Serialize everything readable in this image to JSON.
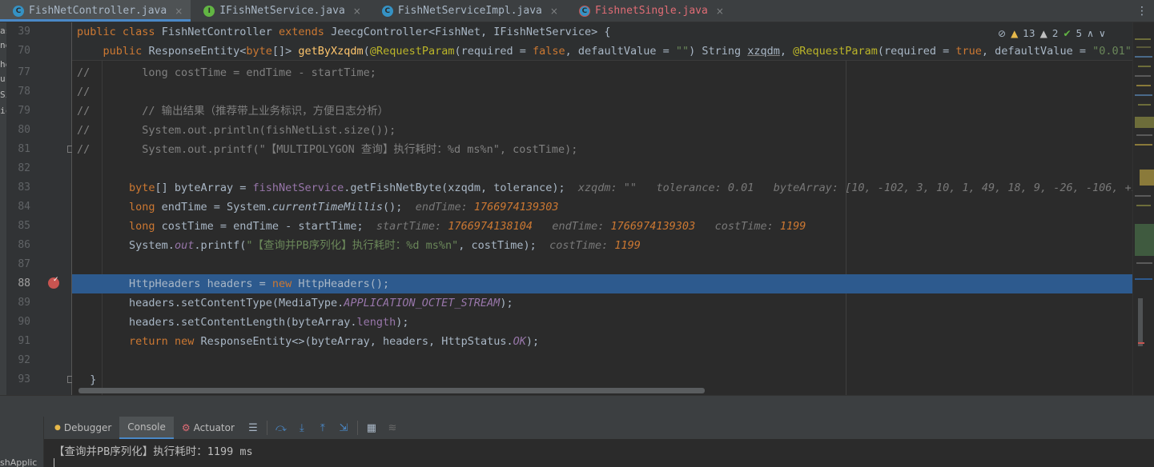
{
  "tabs": [
    {
      "label": "FishNetController.java",
      "icon": "class-icon",
      "active": true
    },
    {
      "label": "IFishNetService.java",
      "icon": "interface-icon",
      "active": false
    },
    {
      "label": "FishNetServiceImpl.java",
      "icon": "class-icon",
      "active": false
    },
    {
      "label": "FishnetSingle.java",
      "icon": "class-error-icon",
      "active": false
    }
  ],
  "tab_close": "×",
  "tab_more": "⋮",
  "left_panel_fragments": [
    "as",
    "ne",
    "he",
    "ur",
    "Si",
    "ic"
  ],
  "line_numbers": [
    "39",
    "70",
    "77",
    "78",
    "79",
    "80",
    "81",
    "82",
    "83",
    "84",
    "85",
    "86",
    "87",
    "88",
    "89",
    "90",
    "91",
    "92",
    "93"
  ],
  "inspections": {
    "warnings": "13",
    "weak_warnings": "2",
    "ok": "5",
    "up": "∧",
    "down": "∨"
  },
  "code": {
    "l39": {
      "public": "public",
      "class": "class",
      "name": "FishNetController",
      "extends": "extends",
      "base": "JeecgController<FishNet, IFishNetService> {"
    },
    "l70": {
      "public": "public",
      "type_a": "ResponseEntity<",
      "byte": "byte",
      "type_b": "[]> ",
      "method": "getByXzqdm",
      "open": "(",
      "ann1": "@RequestParam",
      "args1": "(required = ",
      "false": "false",
      "args2": ", defaultValue = ",
      "s1": "\"\"",
      "args3": ") String ",
      "xzqdm": "xzqdm",
      "comma": ", ",
      "ann2": "@RequestParam",
      "args4": "(required = ",
      "true": "true",
      "args5": ", defaultValue = ",
      "s2": "\"0.01\"",
      "args6": ") d"
    },
    "l77": {
      "prefix": "//",
      "body": "        long costTime = endTime - startTime;"
    },
    "l78": {
      "prefix": "//",
      "body": ""
    },
    "l79": {
      "prefix": "//",
      "body": "        // 输出结果（推荐带上业务标识，方便日志分析）"
    },
    "l80": {
      "prefix": "//",
      "body": "        System.out.println(fishNetList.size());"
    },
    "l81": {
      "prefix": "//",
      "body": "        System.out.printf(\"【MULTIPOLYGON 查询】执行耗时：%d ms%n\", costTime);"
    },
    "l83": {
      "byte": "byte",
      "a": "[] byteArray = ",
      "svc": "fishNetService",
      "b": ".getFishNetByte(xzqdm, tolerance);",
      "h1k": "xzqdm: ",
      "h1v": "\"\"",
      "h2k": "tolerance: ",
      "h2v": "0.01",
      "h3k": "byteArray: ",
      "h3v": "[10, -102, 3, 10, 1, 49, 18, 9, -26, -106, +1"
    },
    "l84": {
      "long": "long",
      "a": " endTime = System.",
      "m": "currentTimeMillis",
      "b": "();",
      "hk": "endTime: ",
      "hv": "1766974139303"
    },
    "l85": {
      "long": "long",
      "a": " costTime = endTime - startTime;",
      "h1k": "startTime: ",
      "h1v": "1766974138104",
      "h2k": "endTime: ",
      "h2v": "1766974139303",
      "h3k": "costTime: ",
      "h3v": "1199"
    },
    "l86": {
      "a": "System.",
      "out": "out",
      "b": ".printf(",
      "s": "\"【查询并PB序列化】执行耗时：%d ms%n\"",
      "c": ", costTime);",
      "hk": "costTime: ",
      "hv": "1199"
    },
    "l88": {
      "a": "HttpHeaders headers = ",
      "new": "new",
      "b": " HttpHeaders();"
    },
    "l89": {
      "a": "headers.setContentType(MediaType.",
      "c": "APPLICATION_OCTET_STREAM",
      "b": ");"
    },
    "l90": {
      "a": "headers.setContentLength(byteArray.",
      "f": "length",
      "b": ");"
    },
    "l91": {
      "ret": "return",
      "new": "new",
      "a": " ResponseEntity<>(byteArray, headers, HttpStatus.",
      "ok": "OK",
      "b": ");"
    },
    "l93": {
      "a": "}"
    }
  },
  "debug": {
    "tabs": [
      "Debugger",
      "Console",
      "Actuator"
    ],
    "active_tab": "Console",
    "toolbar_icons": [
      "menu-icon",
      "step-over-icon",
      "step-into-icon",
      "step-out-icon",
      "run-to-cursor-icon",
      "evaluate-icon",
      "trace-icon"
    ],
    "console_output": "【查询并PB序列化】执行耗时：1199 ms",
    "left_label": "shApplic"
  },
  "colors": {
    "editor_bg": "#2b2b2b",
    "keyword": "#cc7832",
    "string": "#6a8759",
    "method": "#ffc66d",
    "annotation": "#bbb529",
    "comment": "#808080",
    "current_line": "#2d5a8e",
    "inline_value": "#cc7832"
  }
}
